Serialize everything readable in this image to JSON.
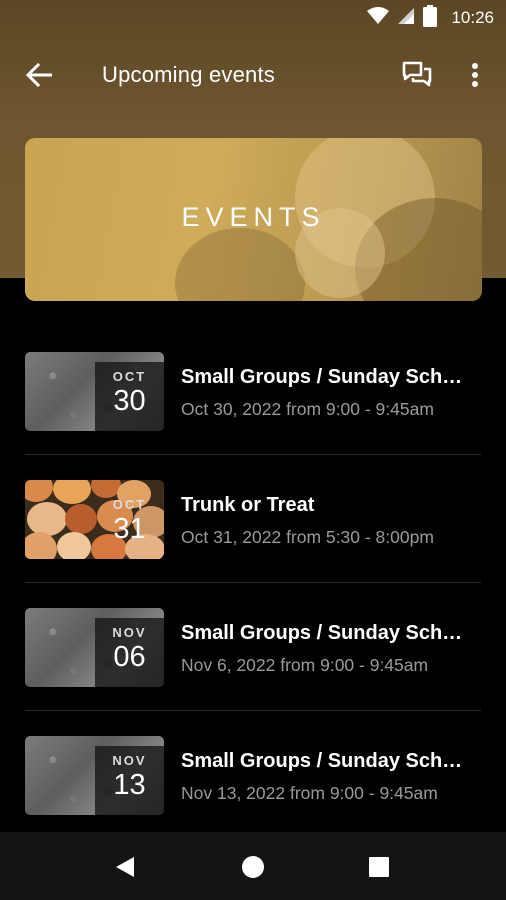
{
  "status_bar": {
    "time": "10:26",
    "icons": [
      "wifi-icon",
      "signal-icon",
      "battery-icon"
    ]
  },
  "app_bar": {
    "title": "Upcoming events",
    "back_icon": "arrow-back-icon",
    "chat_icon": "chat-bubbles-icon",
    "more_icon": "more-vert-icon"
  },
  "banner": {
    "text": "EVENTS"
  },
  "events": [
    {
      "month": "OCT",
      "day": "30",
      "title": "Small Groups / Sunday Sch…",
      "subtitle": "Oct 30, 2022 from 9:00 - 9:45am",
      "thumb": "stone"
    },
    {
      "month": "OCT",
      "day": "31",
      "title": "Trunk or Treat",
      "subtitle": "Oct 31, 2022 from 5:30 - 8:00pm",
      "thumb": "pumpkins"
    },
    {
      "month": "NOV",
      "day": "06",
      "title": "Small Groups / Sunday Sch…",
      "subtitle": "Nov 6, 2022 from 9:00 - 9:45am",
      "thumb": "stone"
    },
    {
      "month": "NOV",
      "day": "13",
      "title": "Small Groups / Sunday Sch…",
      "subtitle": "Nov 13, 2022 from 9:00 - 9:45am",
      "thumb": "stone"
    }
  ],
  "nav_bar": {
    "icons": [
      "back-triangle-icon",
      "home-circle-icon",
      "recents-square-icon"
    ]
  },
  "colors": {
    "header_brown": "#6e5630",
    "banner_gold": "#c9a552",
    "background": "#000000",
    "subtitle_gray": "#9a9a9a"
  }
}
